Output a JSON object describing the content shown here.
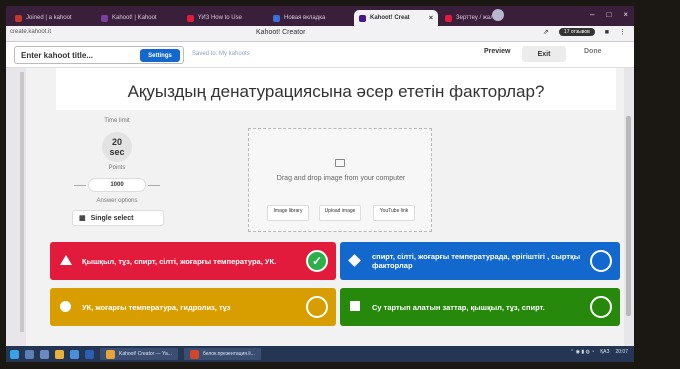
{
  "browser": {
    "tabs": [
      {
        "label": "Joined | a kahoot",
        "color": "#c0392b",
        "active": false
      },
      {
        "label": "Kahoot! | Kahoot",
        "color": "#7b3fa0",
        "active": false
      },
      {
        "label": "ҮИЗ How to Use",
        "color": "#e21b3c",
        "active": false
      },
      {
        "label": "Новая вкладка",
        "color": "#3a6fd8",
        "active": false
      },
      {
        "label": "Kahoot! Creat",
        "color": "#46178f",
        "active": true
      },
      {
        "label": "Зерттеу / жалпы",
        "color": "#e21b3c",
        "active": false
      }
    ],
    "url": "create.kahoot.it",
    "app_title": "Kahoot! Creator",
    "profile_badge": "17 отзывов"
  },
  "kahoot_header": {
    "title_placeholder": "Enter kahoot title...",
    "settings_label": "Settings",
    "saved_label": "Saved to: My kahoots",
    "preview_label": "Preview",
    "exit_label": "Exit",
    "done_label": "Done"
  },
  "question": {
    "text": "Ақуыздың денатурациясына әсер ететін факторлар?",
    "time_limit_label": "Time limit",
    "time_value": "20",
    "time_unit": "sec",
    "points_label": "Points",
    "points_value": "1000",
    "answer_options_label": "Answer options",
    "answer_option_value": "Single select"
  },
  "media": {
    "drop_text": "Drag and drop image from your computer",
    "buttons": [
      "Image library",
      "Upload image",
      "YouTube link"
    ]
  },
  "answers": [
    {
      "text": "Қышқыл, тұз, спирт, сілті, жоғарғы температура, УК.",
      "color": "#e21b3c",
      "shape": "triangle",
      "correct": true
    },
    {
      "text": "спирт, сілті, жоғарғы температурада, ерігіштігі , сыртқы факторлар",
      "color": "#1368ce",
      "shape": "diamond",
      "correct": false
    },
    {
      "text": "УК, жоғарғы температура, гидролиз, тұз",
      "color": "#d89e00",
      "shape": "circle",
      "correct": false
    },
    {
      "text": "Су тартып алатын заттар, қышқыл, тұз, спирт.",
      "color": "#26890c",
      "shape": "square",
      "correct": false
    }
  ],
  "taskbar": {
    "apps": [
      "Kahoot! Creator — Ya...",
      "белок.презентация.li..."
    ],
    "tray_lang": "ҚАЗ",
    "tray_time": "20:07"
  }
}
